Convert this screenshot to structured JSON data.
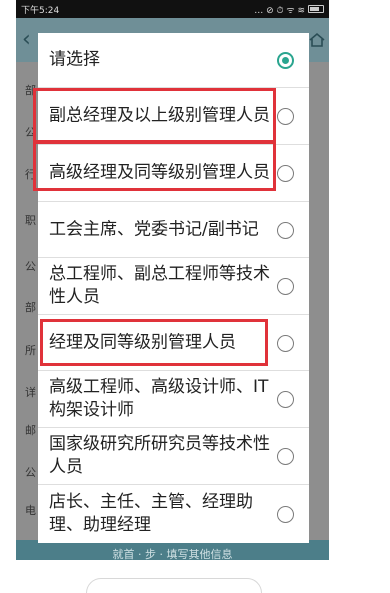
{
  "statusbar": {
    "time": "下午5:24",
    "icons": "… ⊘ ⏱ ᯤ ≋"
  },
  "dialog": {
    "options": [
      {
        "label": "请选择",
        "checked": true
      },
      {
        "label": "副总经理及以上级别管理人员",
        "checked": false
      },
      {
        "label": "高级经理及同等级别管理人员",
        "checked": false
      },
      {
        "label": "工会主席、党委书记/副书记",
        "checked": false
      },
      {
        "label": "总工程师、副总工程师等技术性人员",
        "checked": false
      },
      {
        "label": "经理及同等级别管理人员",
        "checked": false
      },
      {
        "label": "高级工程师、高级设计师、IT构架设计师",
        "checked": false
      },
      {
        "label": "国家级研究所研究员等技术性人员",
        "checked": false
      },
      {
        "label": "店长、主任、主管、经理助理、助理经理",
        "checked": false
      }
    ]
  },
  "background": {
    "labels": [
      "部",
      "公",
      "行",
      "职",
      "公",
      "部",
      "所",
      "详",
      "邮",
      "公",
      "电"
    ],
    "bottom_button": "就首 · 步 · 填写其他信息"
  },
  "colors": {
    "accent": "#2aa58f",
    "highlight": "#e0323a",
    "appbar": "#6f8f97"
  }
}
